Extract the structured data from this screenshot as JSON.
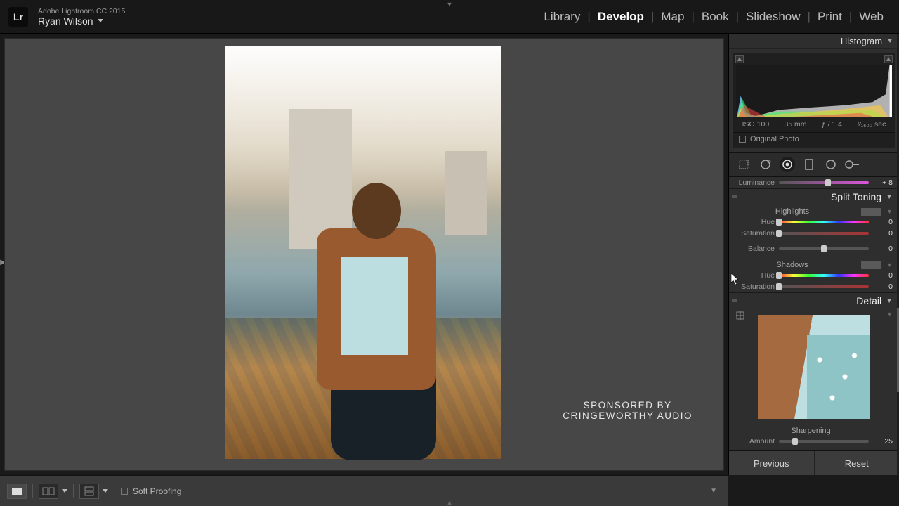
{
  "app": {
    "title": "Adobe Lightroom CC 2015",
    "user": "Ryan Wilson",
    "logo": "Lr"
  },
  "nav": {
    "items": [
      "Library",
      "Develop",
      "Map",
      "Book",
      "Slideshow",
      "Print",
      "Web"
    ],
    "active": "Develop"
  },
  "watermark": {
    "line1": "SPONSORED BY",
    "line2": "CRINGEWORTHY AUDIO"
  },
  "right": {
    "histogram": {
      "title": "Histogram",
      "meta": {
        "iso": "ISO 100",
        "focal": "35 mm",
        "aperture": "ƒ / 1.4",
        "shutter": "¹⁄₁₆₀₀ sec"
      },
      "original_label": "Original Photo"
    },
    "luminance": {
      "label": "Luminance",
      "value": "+ 8",
      "pos": 55
    },
    "split_toning": {
      "title": "Split Toning",
      "highlights": {
        "label": "Highlights",
        "hue": {
          "label": "Hue",
          "value": "0",
          "pos": 0
        },
        "saturation": {
          "label": "Saturation",
          "value": "0",
          "pos": 0
        }
      },
      "balance": {
        "label": "Balance",
        "value": "0",
        "pos": 50
      },
      "shadows": {
        "label": "Shadows",
        "hue": {
          "label": "Hue",
          "value": "0",
          "pos": 0
        },
        "saturation": {
          "label": "Saturation",
          "value": "0",
          "pos": 0
        }
      }
    },
    "detail": {
      "title": "Detail",
      "sharpening": {
        "label": "Sharpening",
        "amount": {
          "label": "Amount",
          "value": "25",
          "pos": 18
        }
      }
    },
    "buttons": {
      "previous": "Previous",
      "reset": "Reset"
    }
  },
  "footer": {
    "soft_proofing": "Soft Proofing"
  },
  "colors": {
    "panel_bg": "#2e2e2e",
    "canvas_bg": "#474747",
    "accent_text": "#ffffff"
  }
}
